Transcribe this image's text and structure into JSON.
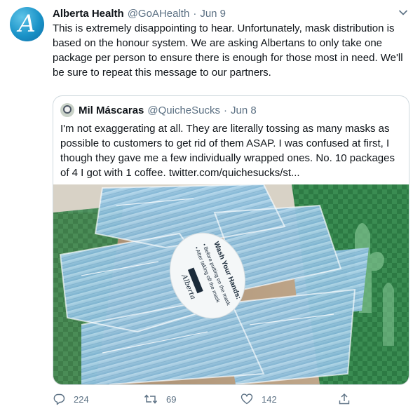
{
  "tweet": {
    "author_name": "Alberta Health",
    "handle": "@GoAHealth",
    "separator": "·",
    "date": "Jun 9",
    "text": "This is extremely disappointing to hear. Unfortunately, mask distribution is based on the honour system. We are asking Albertans to only take one package per person to ensure there is enough for those most in need. We'll be sure to repeat this message to our partners.",
    "avatar_icon": "alberta-logo-icon",
    "more_icon": "chevron-down-icon"
  },
  "quoted": {
    "author_name": "Mil Máscaras",
    "handle": "@QuicheSucks",
    "separator": "·",
    "date": "Jun 8",
    "text": "I'm not exaggerating at all. They are literally tossing as many masks as possible to customers to get rid of them ASAP. I was confused at first, I though they gave me a few individually wrapped ones. No. 10 packages of 4 I got with 1 coffee.  twitter.com/quichesucks/st...",
    "image_sticker_title": "Wash Your Hands:",
    "image_sticker_lines": [
      "• Before putting on the mask",
      "• After taking off the mask"
    ],
    "image_sticker_brand": "Alberta"
  },
  "actions": {
    "reply_count": "224",
    "retweet_count": "69",
    "like_count": "142",
    "reply_icon": "reply-icon",
    "retweet_icon": "retweet-icon",
    "like_icon": "heart-icon",
    "share_icon": "share-icon"
  }
}
